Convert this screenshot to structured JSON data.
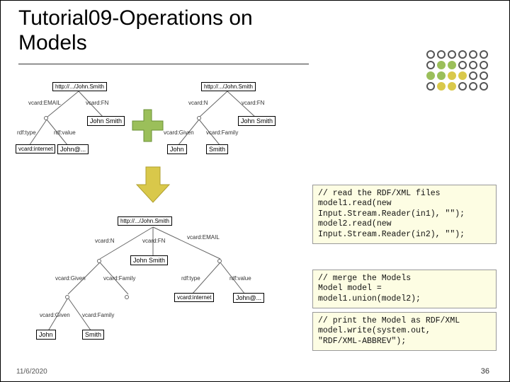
{
  "title": "Tutorial09-Operations on Models",
  "footer": {
    "date": "11/6/2020",
    "page": "36"
  },
  "code": {
    "snippet1": "// read the RDF/XML files\nmodel1.read(new\nInput.Stream.Reader(in1), \"\");\nmodel2.read(new\nInput.Stream.Reader(in2), \"\");",
    "snippet2": "// merge the Models\nModel model =\nmodel1.union(model2);",
    "snippet3": "// print the Model as RDF/XML\nmodel.write(system.out,\n\"RDF/XML-ABBREV\");"
  },
  "graphs": {
    "left": {
      "res": "http://.../John.Smith",
      "edges": {
        "email": "vcard:EMAIL",
        "fn": "vcard:FN"
      },
      "fn_value": "John Smith",
      "sub": {
        "type": "rdf:type",
        "value_edge": "rdf:value",
        "internet": "vcard:internet",
        "mail": "John@..."
      }
    },
    "right": {
      "res": "http://.../John.Smith",
      "edges": {
        "n": "vcard:N",
        "fn": "vcard:FN"
      },
      "fn_value": "John Smith",
      "sub": {
        "given_edge": "vcard:Given",
        "family_edge": "vcard:Family",
        "given": "John",
        "family": "Smith"
      }
    },
    "merged": {
      "res": "http://.../John.Smith",
      "edges": {
        "n": "vcard:N",
        "fn": "vcard:FN",
        "email": "vcard:EMAIL"
      },
      "fn_value": "John Smith",
      "nsub": {
        "given_edge": "vcard:Given",
        "family_edge": "vcard:Family",
        "given": "John",
        "family": "Smith"
      },
      "esub": {
        "type": "rdf:type",
        "value_edge": "rdf:value",
        "internet": "vcard:internet",
        "mail": "John@..."
      }
    }
  }
}
